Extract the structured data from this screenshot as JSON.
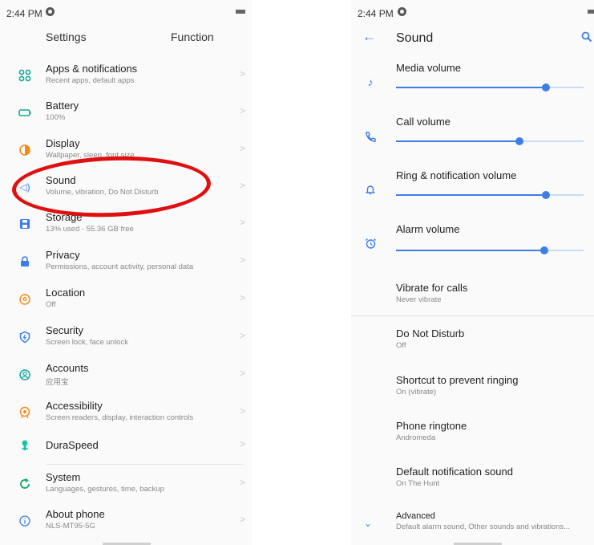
{
  "left": {
    "status": {
      "time": "2:44 PM"
    },
    "header": {
      "settings": "Settings",
      "function": "Function"
    },
    "items": [
      {
        "title": "Apps & notifications",
        "subtitle": "Recent apps, default apps",
        "icon": "apps-icon",
        "color": "#12a89a"
      },
      {
        "title": "Battery",
        "subtitle": "100%",
        "icon": "battery-icon",
        "color": "#12a89a"
      },
      {
        "title": "Display",
        "subtitle": "Wallpaper, sleep, font size",
        "icon": "display-icon",
        "color": "#f38a1a"
      },
      {
        "title": "Sound",
        "subtitle": "Volume, vibration, Do Not Disturb",
        "icon": "sound-icon",
        "color": "#3d7de8"
      },
      {
        "title": "Storage",
        "subtitle": "13% used - 55.36 GB free",
        "icon": "storage-icon",
        "color": "#3d7de8"
      },
      {
        "title": "Privacy",
        "subtitle": "Permissions, account activity, personal data",
        "icon": "lock-icon",
        "color": "#3d7de8"
      },
      {
        "title": "Location",
        "subtitle": "Off",
        "icon": "location-icon",
        "color": "#f38a1a"
      },
      {
        "title": "Security",
        "subtitle": "Screen lock, face unlock",
        "icon": "security-icon",
        "color": "#3d7de8"
      },
      {
        "title": "Accounts",
        "subtitle": "应用宝",
        "icon": "accounts-icon",
        "color": "#12a89a"
      },
      {
        "title": "Accessibility",
        "subtitle": "Screen readers, display, interaction controls",
        "icon": "accessibility-icon",
        "color": "#f38a1a"
      },
      {
        "title": "DuraSpeed",
        "subtitle": "",
        "icon": "duraspeed-icon",
        "color": "#12c8a0"
      },
      {
        "title": "System",
        "subtitle": "Languages, gestures, time, backup",
        "icon": "system-icon",
        "color": "#12a860"
      },
      {
        "title": "About phone",
        "subtitle": "NLS-MT95-5G",
        "icon": "info-icon",
        "color": "#3d7de8"
      }
    ]
  },
  "right": {
    "status": {
      "time": "2:44 PM"
    },
    "appbar": {
      "title": "Sound"
    },
    "volumes": [
      {
        "label": "Media volume",
        "icon": "music-note-icon",
        "level": 0.8
      },
      {
        "label": "Call volume",
        "icon": "phone-icon",
        "level": 0.66
      },
      {
        "label": "Ring & notification volume",
        "icon": "bell-icon",
        "level": 0.8
      },
      {
        "label": "Alarm volume",
        "icon": "alarm-clock-icon",
        "level": 0.79
      }
    ],
    "prefs": [
      {
        "title": "Vibrate for calls",
        "subtitle": "Never vibrate"
      },
      {
        "title": "Do Not Disturb",
        "subtitle": "Off"
      },
      {
        "title": "Shortcut to prevent ringing",
        "subtitle": "On (vibrate)"
      },
      {
        "title": "Phone ringtone",
        "subtitle": "Andromeda"
      },
      {
        "title": "Default notification sound",
        "subtitle": "On The Hunt"
      },
      {
        "title": "Advanced",
        "subtitle": "Default alarm sound, Other sounds and vibrations..."
      }
    ]
  },
  "colors": {
    "accent": "#3d7de8",
    "annotation": "#e01010"
  }
}
